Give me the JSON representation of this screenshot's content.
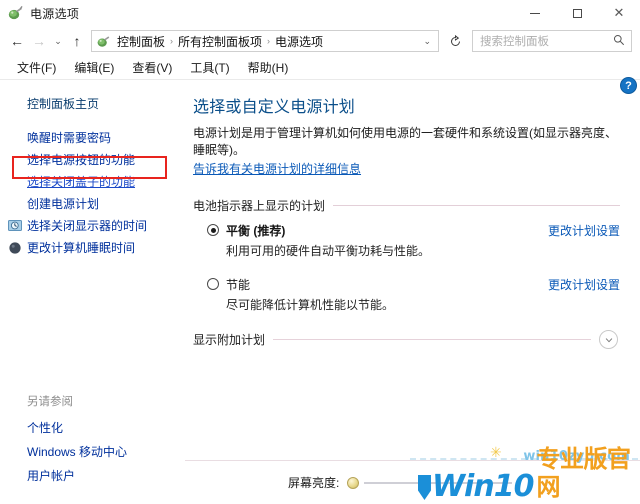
{
  "window": {
    "title": "电源选项",
    "title_icon": "power-plug-icon",
    "minimize_label": "最小化",
    "maximize_label": "最大化",
    "close_label": "关闭"
  },
  "nav": {
    "back_label": "后退",
    "forward_label": "前进",
    "recent_label": "最近的位置",
    "up_label": "向上",
    "refresh_label": "刷新",
    "breadcrumbs": [
      {
        "label": "控制面板"
      },
      {
        "label": "所有控制面板项"
      },
      {
        "label": "电源选项"
      }
    ],
    "separator": "›",
    "chevron": "⌄"
  },
  "search": {
    "placeholder": "搜索控制面板",
    "icon": "search-icon"
  },
  "menu": {
    "items": [
      {
        "label": "文件(F)"
      },
      {
        "label": "编辑(E)"
      },
      {
        "label": "查看(V)"
      },
      {
        "label": "工具(T)"
      },
      {
        "label": "帮助(H)"
      }
    ]
  },
  "sidebar": {
    "home": "控制面板主页",
    "items": [
      {
        "label": "唤醒时需要密码",
        "icon": null
      },
      {
        "label": "选择电源按钮的功能",
        "icon": null
      },
      {
        "label": "选择关闭盖子的功能",
        "icon": null,
        "highlighted": true
      },
      {
        "label": "创建电源计划",
        "icon": null
      },
      {
        "label": "选择关闭显示器的时间",
        "icon": "monitor-clock-icon"
      },
      {
        "label": "更改计算机睡眠时间",
        "icon": "sleep-moon-icon"
      }
    ],
    "see_also_title": "另请参阅",
    "see_also": [
      {
        "label": "个性化"
      },
      {
        "label": "Windows 移动中心"
      },
      {
        "label": "用户帐户"
      }
    ]
  },
  "main": {
    "help_label": "?",
    "heading": "选择或自定义电源计划",
    "description": "电源计划是用于管理计算机如何使用电源的一套硬件和系统设置(如显示器亮度、睡眠等)。",
    "more_info_link": "告诉我有关电源计划的详细信息",
    "group_title": "电池指示器上显示的计划",
    "plans": [
      {
        "name": "平衡 (推荐)",
        "selected": true,
        "description": "利用可用的硬件自动平衡功耗与性能。",
        "change_link": "更改计划设置"
      },
      {
        "name": "节能",
        "selected": false,
        "description": "尽可能降低计算机性能以节能。",
        "change_link": "更改计划设置"
      }
    ],
    "show_additional": "显示附加计划",
    "show_additional_icon": "chevron-down-icon"
  },
  "bottom": {
    "brightness_label": "屏幕亮度:",
    "brightness_value": 8
  },
  "watermark": {
    "domain": "win10zyb.com",
    "logo_latin": "Win10",
    "logo_cn": "专业版官网"
  },
  "colors": {
    "link": "#0a59b7",
    "heading": "#0b4f8a",
    "highlight_box": "#e8241e",
    "accent_blue": "#1b8fd8",
    "accent_orange": "#f2a01e"
  }
}
